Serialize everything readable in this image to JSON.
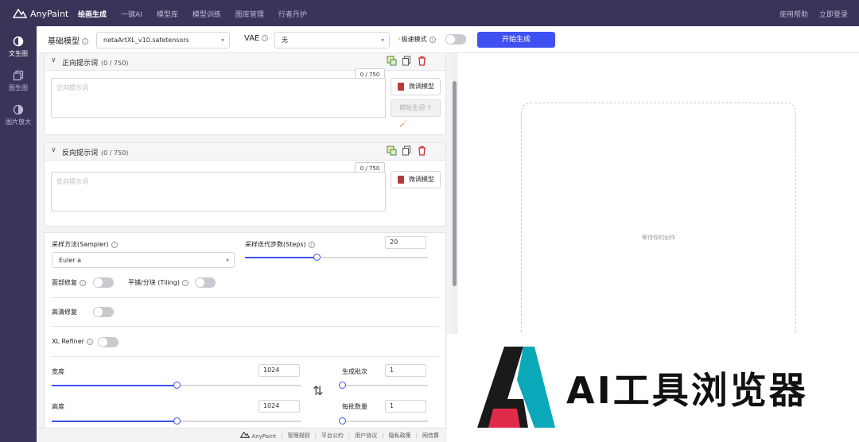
{
  "app": {
    "name": "AnyPaint"
  },
  "nav": {
    "items": [
      "绘画生成",
      "一键AI",
      "模型库",
      "模型训练",
      "图库管理",
      "行者丹护"
    ],
    "active_index": 0
  },
  "topright": {
    "help": "使用帮助",
    "login": "立即登录"
  },
  "sidebar": {
    "items": [
      {
        "label": "文生图",
        "icon": "half-circle-icon"
      },
      {
        "label": "图生图",
        "icon": "image-copy-icon"
      },
      {
        "label": "图片放大",
        "icon": "upscale-icon"
      }
    ],
    "active_index": 0
  },
  "controls": {
    "base_model_label": "基础模型",
    "base_model_value": "netaArtXL_v10.safetensors",
    "vae_label": "VAE",
    "vae_value": "无",
    "fast_mode_label": "极速模式",
    "fast_mode_on": false,
    "generate_label": "开始生成"
  },
  "positive": {
    "title": "正向提示词",
    "count": "(0 / 750)",
    "counter": "0 / 750",
    "placeholder": "正向提示词",
    "finetune_label": "微调模型",
    "assist_label": "帮帖生词 ↑"
  },
  "negative": {
    "title": "反向提示词",
    "count": "(0 / 750)",
    "counter": "0 / 750",
    "placeholder": "反向提示词",
    "finetune_label": "微调模型"
  },
  "params": {
    "sampler_label": "采样方法(Sampler)",
    "sampler_value": "Euler a",
    "steps_label": "采样迭代步数(Steps)",
    "steps_value": "20",
    "steps_fraction": 0.39,
    "face_fix_label": "面部修复",
    "face_fix_on": false,
    "tiling_label": "平铺/分块 (Tiling)",
    "tiling_on": false,
    "hires_label": "高清修复",
    "hires_on": false,
    "refiner_label": "XL Refiner",
    "refiner_on": false,
    "width_label": "宽度",
    "width_value": "1024",
    "width_fraction": 0.5,
    "height_label": "高度",
    "height_value": "1024",
    "height_fraction": 0.5,
    "batch_count_label": "生成批次",
    "batch_count_value": "1",
    "batch_count_fraction": 0,
    "batch_size_label": "每批数量",
    "batch_size_value": "1",
    "batch_size_fraction": 0,
    "swap_symbol": "⇅"
  },
  "preview": {
    "placeholder": "等待你的创作"
  },
  "footer": {
    "brand": "AnyPaint",
    "links": [
      "管理规则",
      "平台公约",
      "用户协议",
      "隐私政策",
      "网信算"
    ]
  },
  "watermark": {
    "text": "AI工具浏览器"
  }
}
